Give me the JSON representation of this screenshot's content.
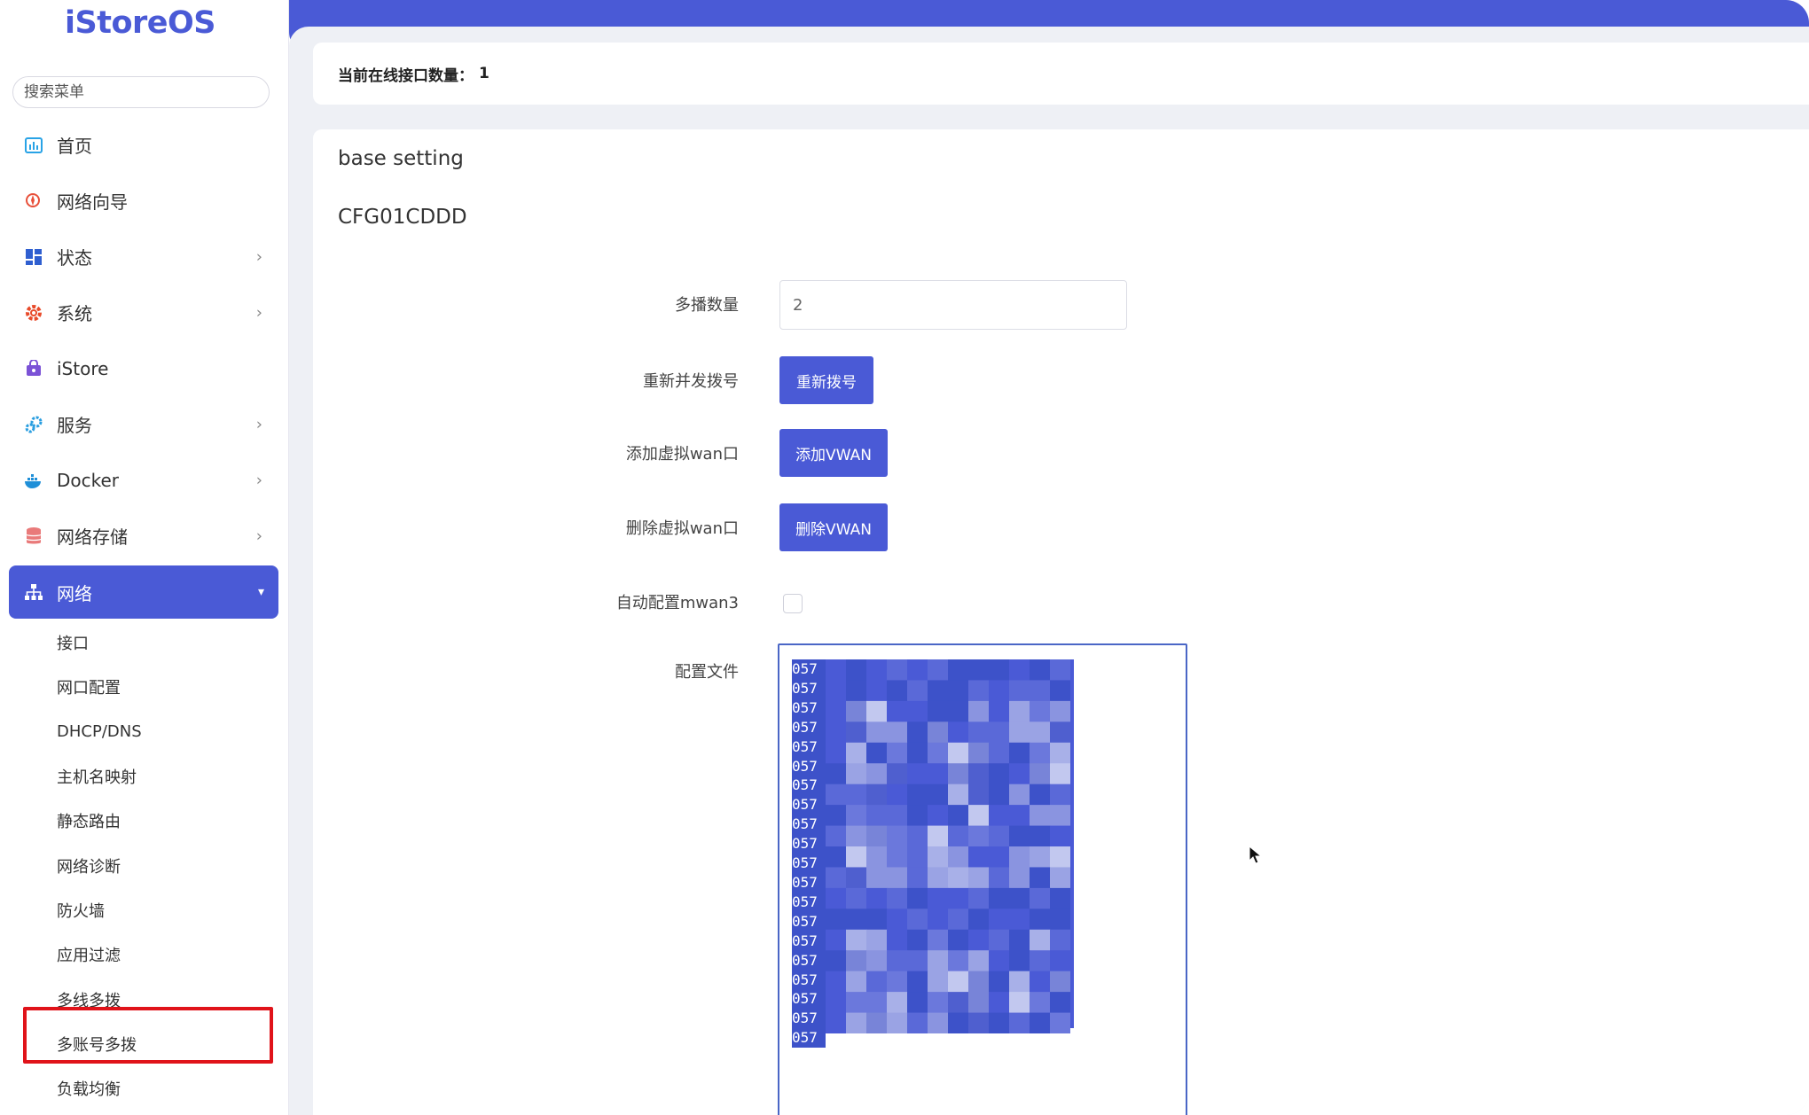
{
  "app": {
    "logo": "iStoreOS"
  },
  "sidebar": {
    "search_placeholder": "搜索菜单",
    "items": [
      {
        "label": "首页",
        "icon": "dashboard-icon",
        "has_children": false
      },
      {
        "label": "网络向导",
        "icon": "guide-icon",
        "has_children": false
      },
      {
        "label": "状态",
        "icon": "status-grid-icon",
        "has_children": true
      },
      {
        "label": "系统",
        "icon": "gear-icon",
        "has_children": true
      },
      {
        "label": "iStore",
        "icon": "store-bag-icon",
        "has_children": false
      },
      {
        "label": "服务",
        "icon": "services-icon",
        "has_children": true
      },
      {
        "label": "Docker",
        "icon": "docker-icon",
        "has_children": true
      },
      {
        "label": "网络存储",
        "icon": "storage-icon",
        "has_children": true
      },
      {
        "label": "网络",
        "icon": "network-icon",
        "has_children": true,
        "expanded": true
      }
    ],
    "network_sub": [
      "接口",
      "网口配置",
      "DHCP/DNS",
      "主机名映射",
      "静态路由",
      "网络诊断",
      "防火墙",
      "应用过滤",
      "多线多拨",
      "多账号多拨",
      "负载均衡"
    ],
    "selected_sub": "多账号多拨"
  },
  "status": {
    "label": "当前在线接口数量：",
    "value": "1"
  },
  "form": {
    "section_title": "base setting",
    "section_sub": "CFG01CDDD",
    "multicast_label": "多播数量",
    "multicast_value": "2",
    "redial_label": "重新并发拨号",
    "redial_button": "重新拨号",
    "add_vwan_label": "添加虚拟wan口",
    "add_vwan_button": "添加VWAN",
    "del_vwan_label": "删除虚拟wan口",
    "del_vwan_button": "删除VWAN",
    "auto_mwan_label": "自动配置mwan3",
    "auto_mwan_checked": false,
    "config_file_label": "配置文件",
    "config_lines": [
      "057",
      "057",
      "057",
      "057",
      "057",
      "057",
      "057",
      "057",
      "057",
      "057",
      "057",
      "057",
      "057",
      "057",
      "057",
      "057",
      "057",
      "057",
      "057",
      "057"
    ]
  },
  "colors": {
    "accent": "#4a5ad6",
    "highlight": "#e0131a"
  }
}
